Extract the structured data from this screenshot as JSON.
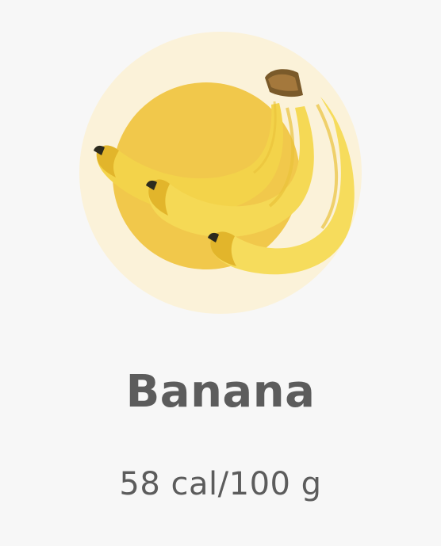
{
  "food": {
    "name": "Banana",
    "calories": "58 cal/100 g",
    "icon": "banana-icon",
    "colors": {
      "outer_circle": "#fbf2d9",
      "inner_circle": "#f1c84b",
      "banana": "#f3d34a",
      "banana_shadow": "#e2b52b",
      "text": "#5c5c5c",
      "background": "#f7f7f7"
    }
  }
}
